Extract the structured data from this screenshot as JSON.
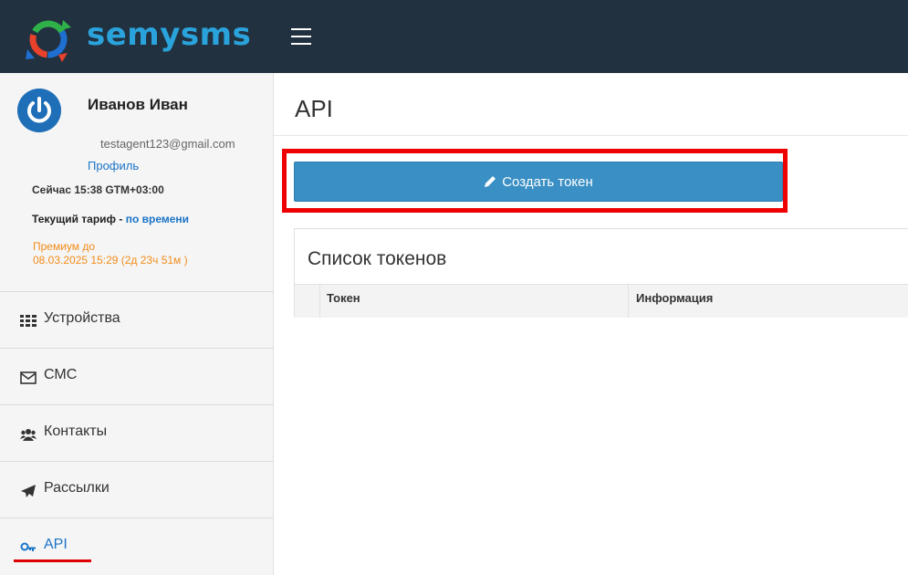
{
  "header": {
    "logo_text": "semysms",
    "menu_icon": "hamburger-icon",
    "logo_icon": "semysms-logo-icon"
  },
  "profile": {
    "name": "Иванов Иван",
    "email": "testagent123@gmail.com",
    "profile_link": "Профиль",
    "time": "Сейчас 15:38 GTM+03:00",
    "tariff_label": "Текущий тариф - ",
    "tariff_value": "по времени",
    "premium_line1": "Премиум до",
    "premium_line2": "08.03.2025 15:29 (2д 23ч 51м )",
    "avatar_icon": "power-icon"
  },
  "sidebar": {
    "items": [
      {
        "label": "Устройства",
        "icon": "grid-icon"
      },
      {
        "label": "СМС",
        "icon": "envelope-icon"
      },
      {
        "label": "Контакты",
        "icon": "users-icon"
      },
      {
        "label": "Рассылки",
        "icon": "paper-plane-icon"
      },
      {
        "label": "API",
        "icon": "key-icon",
        "active": true
      }
    ]
  },
  "main": {
    "title": "API",
    "create_button": "Создать токен",
    "create_icon": "pencil-icon",
    "panel_title": "Список токенов",
    "table": {
      "columns": [
        "Токен",
        "Информация"
      ],
      "rows": []
    }
  },
  "colors": {
    "topbar": "#22313f",
    "logo": "#2aa3dc",
    "button": "#3a8fc4",
    "link": "#1a73c8",
    "premium": "#f28c1a",
    "highlight": "#ee0000"
  }
}
